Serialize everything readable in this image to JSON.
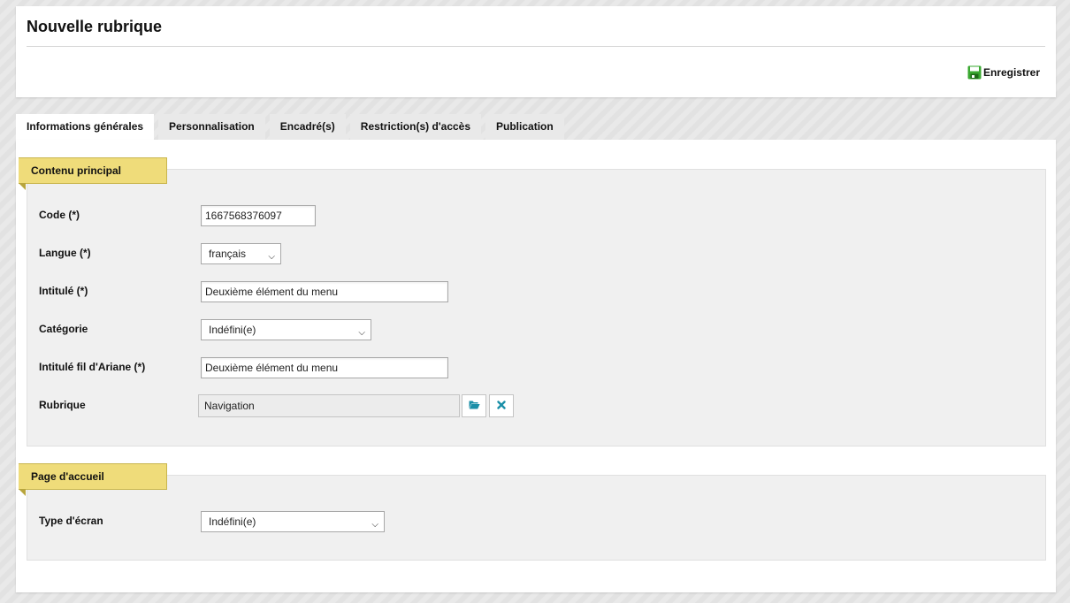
{
  "header": {
    "title": "Nouvelle rubrique",
    "save_label": "Enregistrer"
  },
  "tabs": [
    {
      "label": "Informations générales",
      "active": true
    },
    {
      "label": "Personnalisation",
      "active": false
    },
    {
      "label": "Encadré(s)",
      "active": false
    },
    {
      "label": "Restriction(s) d'accès",
      "active": false
    },
    {
      "label": "Publication",
      "active": false
    }
  ],
  "sections": {
    "main": {
      "title": "Contenu principal",
      "code": {
        "label": "Code (*)",
        "value": "1667568376097"
      },
      "langue": {
        "label": "Langue (*)",
        "value": "français"
      },
      "intitule": {
        "label": "Intitulé (*)",
        "value": "Deuxième élément du menu"
      },
      "categorie": {
        "label": "Catégorie",
        "value": "Indéfini(e)"
      },
      "fil_ariane": {
        "label": "Intitulé fil d'Ariane (*)",
        "value": "Deuxième élément du menu"
      },
      "rubrique": {
        "label": "Rubrique",
        "value": "Navigation"
      }
    },
    "home": {
      "title": "Page d'accueil",
      "type_ecran": {
        "label": "Type d'écran",
        "value": "Indéfini(e)"
      }
    }
  },
  "icons": {
    "save": "floppy-disk-icon",
    "browse": "folder-open-icon",
    "clear": "close-icon",
    "dropdown": "chevron-down-icon"
  },
  "colors": {
    "section_label_bg": "#efdc7a",
    "save_icon": "#3aa830",
    "action_icon": "#1b8fa8"
  }
}
